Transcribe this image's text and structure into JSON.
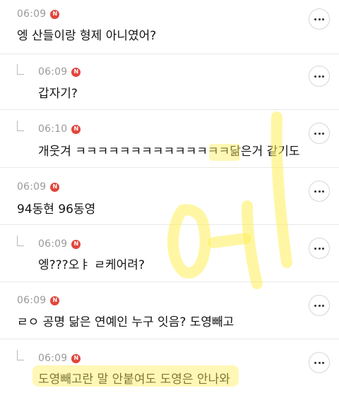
{
  "comments": [
    {
      "time": "06:09",
      "badge": "N",
      "text": "엥 산들이랑 형제 아니였어?",
      "is_reply": false
    },
    {
      "time": "06:09",
      "badge": "N",
      "text": "갑자기?",
      "is_reply": true
    },
    {
      "time": "06:10",
      "badge": "N",
      "text": "개웃겨 ㅋㅋㅋㅋㅋㅋㅋㅋㅋㅋㅋㅋㅋㅋ닮은거 같기도",
      "is_reply": true
    },
    {
      "time": "06:09",
      "badge": "N",
      "text": "94동현 96동영",
      "is_reply": false
    },
    {
      "time": "06:09",
      "badge": "N",
      "text": "엥???오ㅑ ㄹ케어려?",
      "is_reply": true
    },
    {
      "time": "06:09",
      "badge": "N",
      "text": "ㄹㅇ 공명 닮은 연예인 누구 잇음? 도영빼고",
      "is_reply": false
    },
    {
      "time": "06:09",
      "badge": "N",
      "text": "도영빼고란 말 안붙여도 도영은 안나와",
      "is_reply": true
    }
  ],
  "colors": {
    "badge": "#e2453c",
    "timestamp": "#9a9a9a",
    "highlight": "#ffee5a"
  },
  "icons": {
    "more": "more-horizontal-icon",
    "reply": "reply-arrow-icon"
  }
}
